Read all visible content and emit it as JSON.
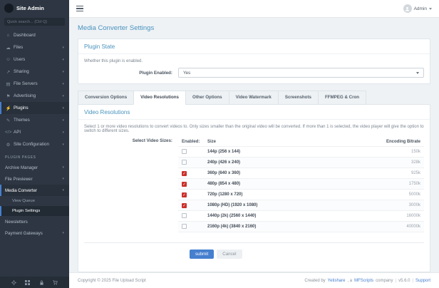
{
  "sidebar": {
    "logo_text": "Site Admin",
    "search_placeholder": "Quick search... (Ctrl Q)",
    "items": [
      {
        "label": "Dashboard",
        "glyph": "⌂"
      },
      {
        "label": "Files",
        "glyph": "☁"
      },
      {
        "label": "Users",
        "glyph": "☺"
      },
      {
        "label": "Sharing",
        "glyph": "↗"
      },
      {
        "label": "File Servers",
        "glyph": "▤"
      },
      {
        "label": "Advertising",
        "glyph": "⚑"
      },
      {
        "label": "Plugins",
        "glyph": "⚡"
      },
      {
        "label": "Themes",
        "glyph": "✎"
      },
      {
        "label": "API",
        "glyph": "</>"
      },
      {
        "label": "Site Configuration",
        "glyph": "⚙"
      }
    ],
    "section_label": "PLUGIN PAGES",
    "plugin_pages": [
      {
        "label": "Archive Manager"
      },
      {
        "label": "File Previewer"
      },
      {
        "label": "Media Converter"
      },
      {
        "label": "View Queue"
      },
      {
        "label": "Plugin Settings"
      },
      {
        "label": "Newsletters"
      },
      {
        "label": "Payment Gateways"
      }
    ]
  },
  "topbar": {
    "user_label": "Admin"
  },
  "page": {
    "title": "Media Converter Settings"
  },
  "plugin_state": {
    "heading": "Plugin State",
    "description": "Whether this plugin is enabled.",
    "field_label": "Plugin Enabled:",
    "value": "Yes"
  },
  "tabs": [
    {
      "label": "Conversion Options",
      "active": false
    },
    {
      "label": "Video Resolutions",
      "active": true
    },
    {
      "label": "Other Options",
      "active": false
    },
    {
      "label": "Video Watermark",
      "active": false
    },
    {
      "label": "Screenshots",
      "active": false
    },
    {
      "label": "FFMPEG & Cron",
      "active": false
    }
  ],
  "video_resolutions": {
    "heading": "Video Resolutions",
    "description": "Select 1 or more video resolutions to convert videos to. Only sizes smaller than the original video will be converted. If more than 1 is selected, the video player will give the option to switch to different sizes.",
    "field_label": "Select Video Sizes:",
    "columns": [
      "Enabled:",
      "Size",
      "Encoding Bitrate"
    ],
    "rows": [
      {
        "size": "144p  (256 x 144)",
        "bitrate": "150k",
        "enabled": false
      },
      {
        "size": "240p  (426 x 240)",
        "bitrate": "328k",
        "enabled": false
      },
      {
        "size": "360p  (640 x 360)",
        "bitrate": "925k",
        "enabled": true
      },
      {
        "size": "480p  (854 x 480)",
        "bitrate": "1750k",
        "enabled": true
      },
      {
        "size": "720p  (1280 x 720)",
        "bitrate": "5000k",
        "enabled": true
      },
      {
        "size": "1080p (HD)  (1920 x 1080)",
        "bitrate": "3000k",
        "enabled": true
      },
      {
        "size": "1440p (2k)  (2560 x 1440)",
        "bitrate": "16000k",
        "enabled": false
      },
      {
        "size": "2160p (4k)  (3840 x 2160)",
        "bitrate": "40000k",
        "enabled": false
      }
    ]
  },
  "actions": {
    "submit": "submit",
    "cancel": "Cancel"
  },
  "footer": {
    "copyright": "Copyright © 2025 File Upload Script",
    "created_by": "Created by",
    "brand": "Yetishare",
    "mid": ", a",
    "company": "MFScripts",
    "suffix": "company",
    "pipe": "|",
    "version": "v5.6.0",
    "support": "Support"
  }
}
